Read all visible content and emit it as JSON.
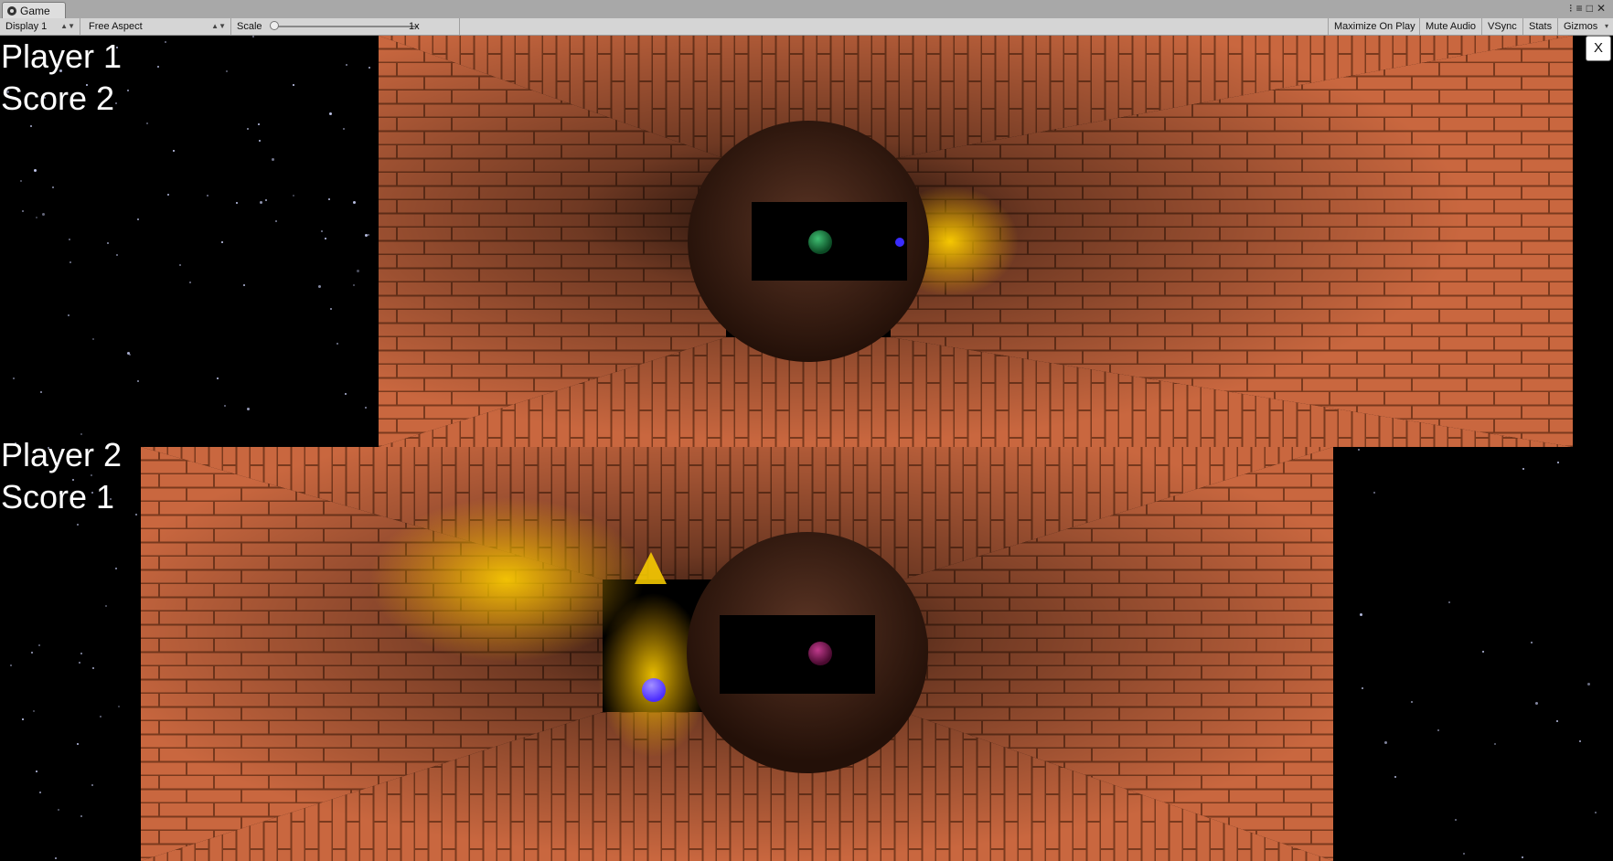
{
  "window": {
    "tab_title": "Game",
    "tab_icon": "unity-game-icon",
    "controls": [
      "menu-icon",
      "maximize-icon",
      "close-icon"
    ]
  },
  "toolbar": {
    "display": "Display 1",
    "aspect": "Free Aspect",
    "scale_label": "Scale",
    "scale_value": "1x",
    "maximize_on_play": "Maximize On Play",
    "mute_audio": "Mute Audio",
    "vsync": "VSync",
    "stats": "Stats",
    "gizmos": "Gizmos"
  },
  "game": {
    "player1": {
      "name": "Player 1",
      "score": "Score 2"
    },
    "player2": {
      "name": "Player 2",
      "score": "Score 1"
    },
    "close_label": "X",
    "colors": {
      "brick": "#c8663e",
      "brick_dark": "#5a2512",
      "glow": "#ffc400",
      "ball_green": "#1f8a4a",
      "ball_magenta": "#8a1e62",
      "ball_blue": "#3a2cff",
      "ball_violet": "#6b4cff"
    }
  }
}
